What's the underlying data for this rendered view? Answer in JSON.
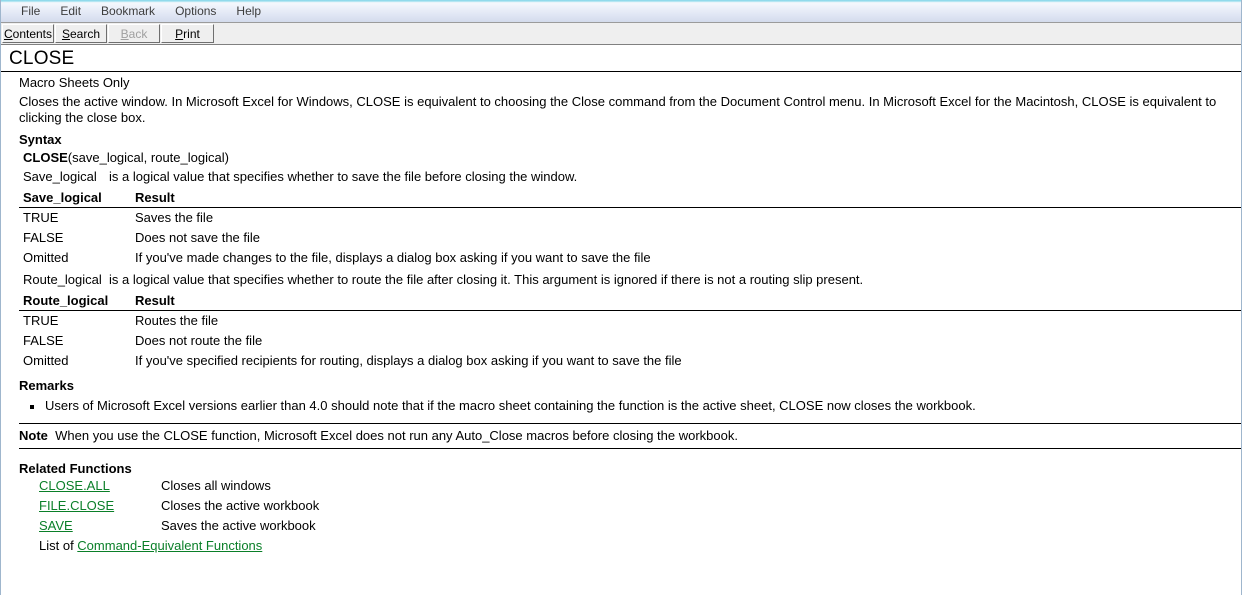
{
  "window": {
    "title": "CLOSE"
  },
  "menubar": {
    "items": [
      {
        "label": "File"
      },
      {
        "label": "Edit"
      },
      {
        "label": "Bookmark"
      },
      {
        "label": "Options"
      },
      {
        "label": "Help"
      }
    ]
  },
  "toolbar": {
    "buttons": [
      {
        "accel": "C",
        "rest": "ontents",
        "disabled": false
      },
      {
        "accel": "S",
        "rest": "earch",
        "disabled": false
      },
      {
        "accel": "B",
        "rest": "ack",
        "disabled": true
      },
      {
        "accel": "P",
        "rest": "rint",
        "disabled": false
      }
    ]
  },
  "topic": {
    "title": "CLOSE",
    "applies_to": "Macro Sheets Only",
    "description": "Closes the active window. In Microsoft Excel for Windows, CLOSE is equivalent to choosing the Close command from the Document Control menu. In Microsoft Excel for the Macintosh, CLOSE is equivalent to clicking the close box.",
    "syntax": {
      "heading": "Syntax",
      "function_name": "CLOSE",
      "arguments": "(save_logical, route_logical)"
    },
    "arguments": [
      {
        "name": "Save_logical",
        "description": "is a logical value that specifies whether to save the file before closing the window.",
        "table": {
          "header": {
            "col_a": "Save_logical",
            "col_b": "Result"
          },
          "rows": [
            {
              "col_a": "TRUE",
              "col_b": "Saves the file"
            },
            {
              "col_a": "FALSE",
              "col_b": "Does not save the file"
            },
            {
              "col_a": "Omitted",
              "col_b": "If you've made changes to the file, displays a dialog box asking if you want to save the file"
            }
          ]
        }
      },
      {
        "name": "Route_logical",
        "description": "is a logical value that specifies whether to route the file after closing it. This argument is ignored if there is not a routing slip present.",
        "table": {
          "header": {
            "col_a": "Route_logical",
            "col_b": "Result"
          },
          "rows": [
            {
              "col_a": "TRUE",
              "col_b": "Routes the file"
            },
            {
              "col_a": "FALSE",
              "col_b": "Does not route the file"
            },
            {
              "col_a": "Omitted",
              "col_b": "If you've specified recipients for routing, displays a dialog box asking if you want to save the file"
            }
          ]
        }
      }
    ],
    "remarks": {
      "heading": "Remarks",
      "items": [
        "Users of Microsoft Excel versions earlier than 4.0 should note that if the macro sheet containing the function is the active sheet, CLOSE now closes the workbook."
      ]
    },
    "note": {
      "label": "Note",
      "text": "When you use the CLOSE function, Microsoft Excel does not run any Auto_Close macros before closing the workbook."
    },
    "related_functions": {
      "heading": "Related Functions",
      "items": [
        {
          "link": "CLOSE.ALL",
          "description": "Closes all windows"
        },
        {
          "link": "FILE.CLOSE",
          "description": "Closes the active workbook"
        },
        {
          "link": "SAVE",
          "description": "Saves the active workbook"
        }
      ],
      "list_of_prefix": "List of ",
      "list_of_link": "Command-Equivalent Functions"
    }
  },
  "colors": {
    "hyperlink": "#0a7f28",
    "menubar_text": "#3d3d3d",
    "toolbar_bg": "#efefef",
    "disabled_text": "#a0a0a0"
  }
}
